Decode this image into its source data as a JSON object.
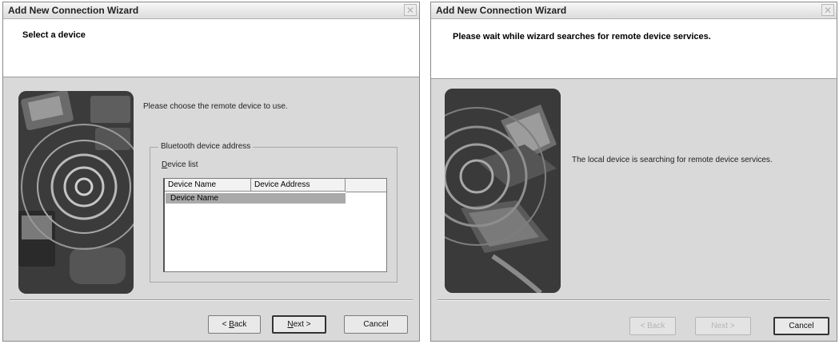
{
  "dialog1": {
    "title": "Add New Connection Wizard",
    "header": "Select a device",
    "instruction": "Please choose the remote device to use.",
    "group_label": "Bluetooth device address",
    "device_list_label_prefix": "D",
    "device_list_label_rest": "evice list",
    "columns": [
      "Device Name",
      "Device Address"
    ],
    "rows": [
      [
        "Device Name",
        ""
      ]
    ],
    "buttons": {
      "back_prefix": "< ",
      "back_ul": "B",
      "back_rest": "ack",
      "next_ul": "N",
      "next_rest": "ext >",
      "cancel": "Cancel"
    }
  },
  "dialog2": {
    "title": "Add New Connection Wizard",
    "header": "Please wait while wizard searches for remote device services.",
    "status": "The local device is searching for remote device services.",
    "buttons": {
      "back": "< Back",
      "next": "Next >",
      "cancel": "Cancel"
    }
  },
  "icons": {
    "close": "close-icon",
    "art1": "bluetooth-devices-illustration",
    "art2": "laptop-signal-illustration"
  }
}
